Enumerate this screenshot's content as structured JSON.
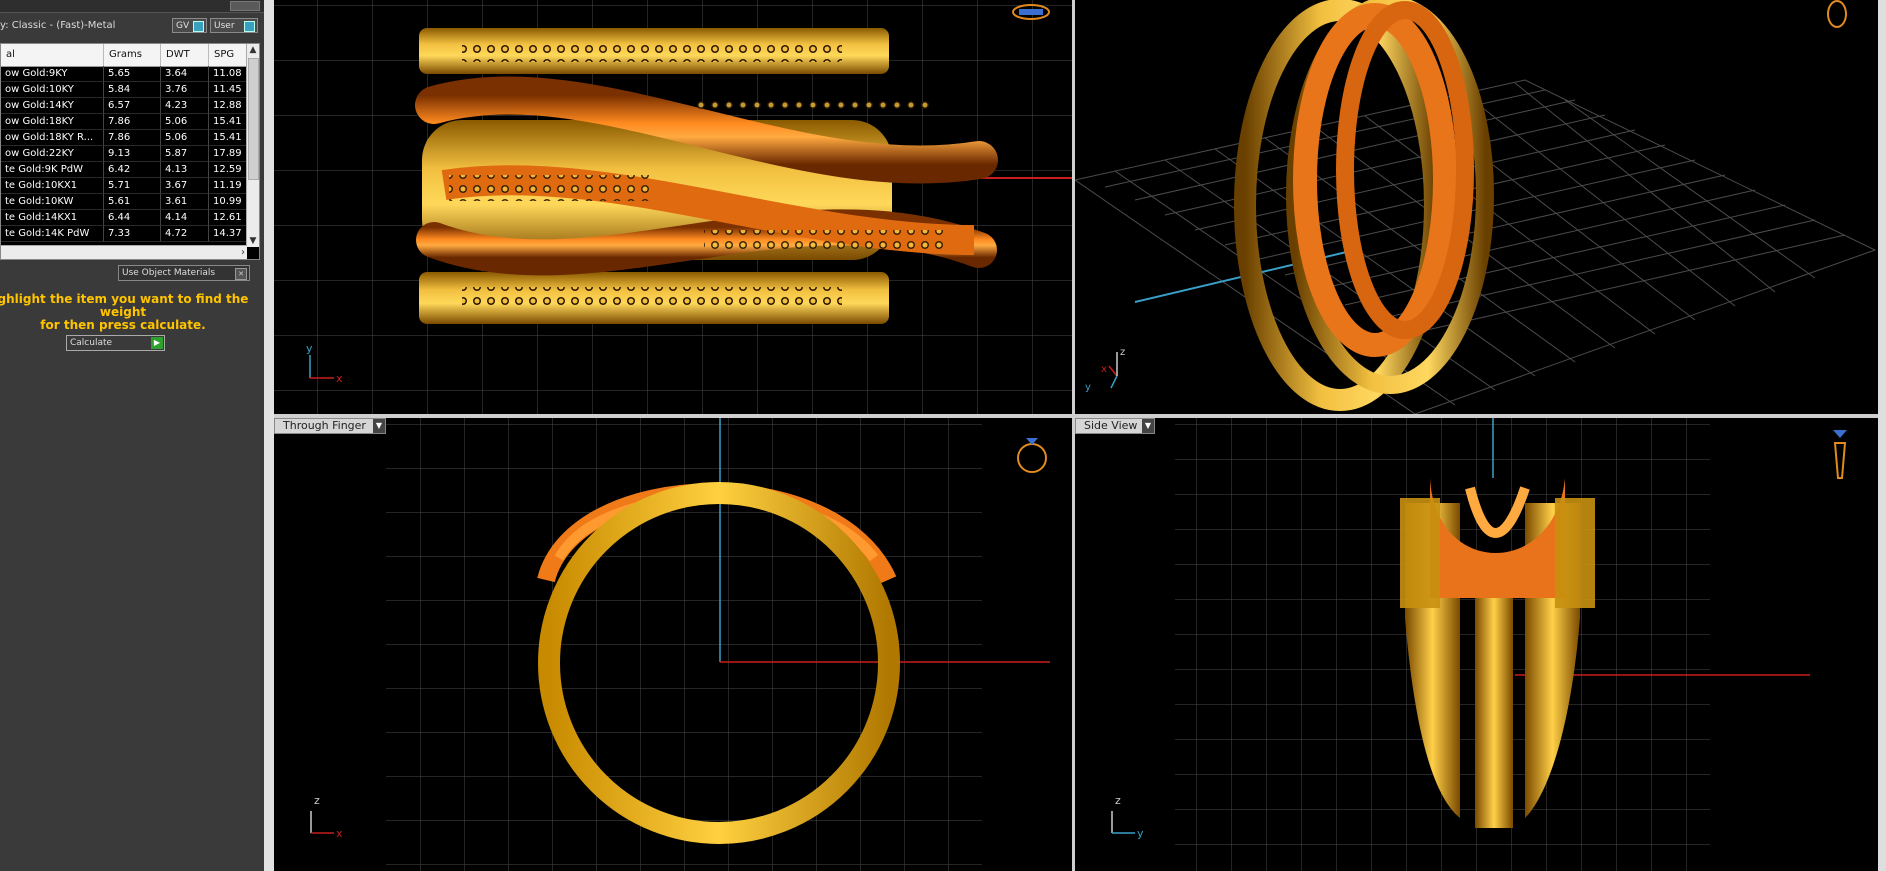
{
  "library": {
    "title": "y: Classic - (Fast)-Metal",
    "gv_label": "GV",
    "user_label": "User"
  },
  "metal_table": {
    "headers": [
      "al",
      "Grams",
      "DWT",
      "SPG"
    ],
    "rows": [
      [
        "ow Gold:9KY",
        "5.65",
        "3.64",
        "11.08"
      ],
      [
        "ow Gold:10KY",
        "5.84",
        "3.76",
        "11.45"
      ],
      [
        "ow Gold:14KY",
        "6.57",
        "4.23",
        "12.88"
      ],
      [
        "ow Gold:18KY",
        "7.86",
        "5.06",
        "15.41"
      ],
      [
        "ow Gold:18KY R...",
        "7.86",
        "5.06",
        "15.41"
      ],
      [
        "ow Gold:22KY",
        "9.13",
        "5.87",
        "17.89"
      ],
      [
        "te Gold:9K PdW",
        "6.42",
        "4.13",
        "12.59"
      ],
      [
        "te Gold:10KX1",
        "5.71",
        "3.67",
        "11.19"
      ],
      [
        "te Gold:10KW",
        "5.61",
        "3.61",
        "10.99"
      ],
      [
        "te Gold:14KX1",
        "6.44",
        "4.14",
        "12.61"
      ],
      [
        "te Gold:14K PdW",
        "7.33",
        "4.72",
        "14.37"
      ]
    ]
  },
  "use_object_materials": "Use Object Materials",
  "hint_line1": "ghlight the item you want to find the weight",
  "hint_line2": "for then press calculate.",
  "calculate_label": "Calculate",
  "viewports": {
    "bottom_left_label": "Through Finger",
    "bottom_right_label": "Side View"
  },
  "axes": {
    "x": "x",
    "y": "y",
    "z": "z"
  },
  "colors": {
    "gold": "#e0a020",
    "orange": "#f07818",
    "grid": "#505050",
    "accent_hint": "#ffc400",
    "axis_red": "#c81e1e",
    "axis_blue": "#3aa0c8"
  }
}
